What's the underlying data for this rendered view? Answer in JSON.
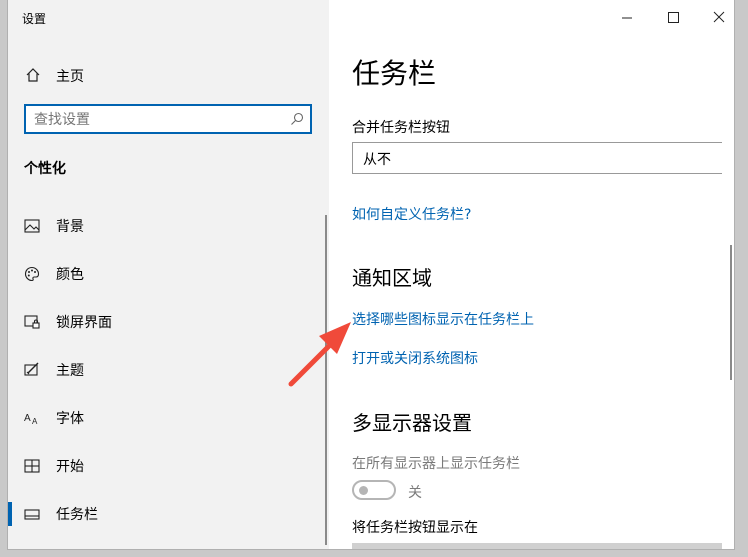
{
  "window": {
    "title": "设置",
    "controls": {
      "minimize": "minimize",
      "maximize": "maximize",
      "close": "close"
    }
  },
  "sidebar": {
    "home_label": "主页",
    "search_placeholder": "查找设置",
    "section_title": "个性化",
    "items": [
      {
        "label": "背景",
        "icon": "image-icon"
      },
      {
        "label": "颜色",
        "icon": "palette-icon"
      },
      {
        "label": "锁屏界面",
        "icon": "lock-screen-icon"
      },
      {
        "label": "主题",
        "icon": "theme-icon"
      },
      {
        "label": "字体",
        "icon": "font-icon"
      },
      {
        "label": "开始",
        "icon": "start-icon"
      },
      {
        "label": "任务栏",
        "icon": "taskbar-icon",
        "active": true
      }
    ]
  },
  "main": {
    "title": "任务栏",
    "combine_label": "合并任务栏按钮",
    "combine_value": "从不",
    "customize_link": "如何自定义任务栏?",
    "notification_heading": "通知区域",
    "notification_links": [
      "选择哪些图标显示在任务栏上",
      "打开或关闭系统图标"
    ],
    "multi_display_heading": "多显示器设置",
    "show_on_all_label": "在所有显示器上显示任务栏",
    "show_on_all_toggle": "关",
    "show_buttons_on_label": "将任务栏按钮显示在"
  },
  "colors": {
    "accent": "#0063b1",
    "annotation_arrow": "#f04a3a"
  }
}
